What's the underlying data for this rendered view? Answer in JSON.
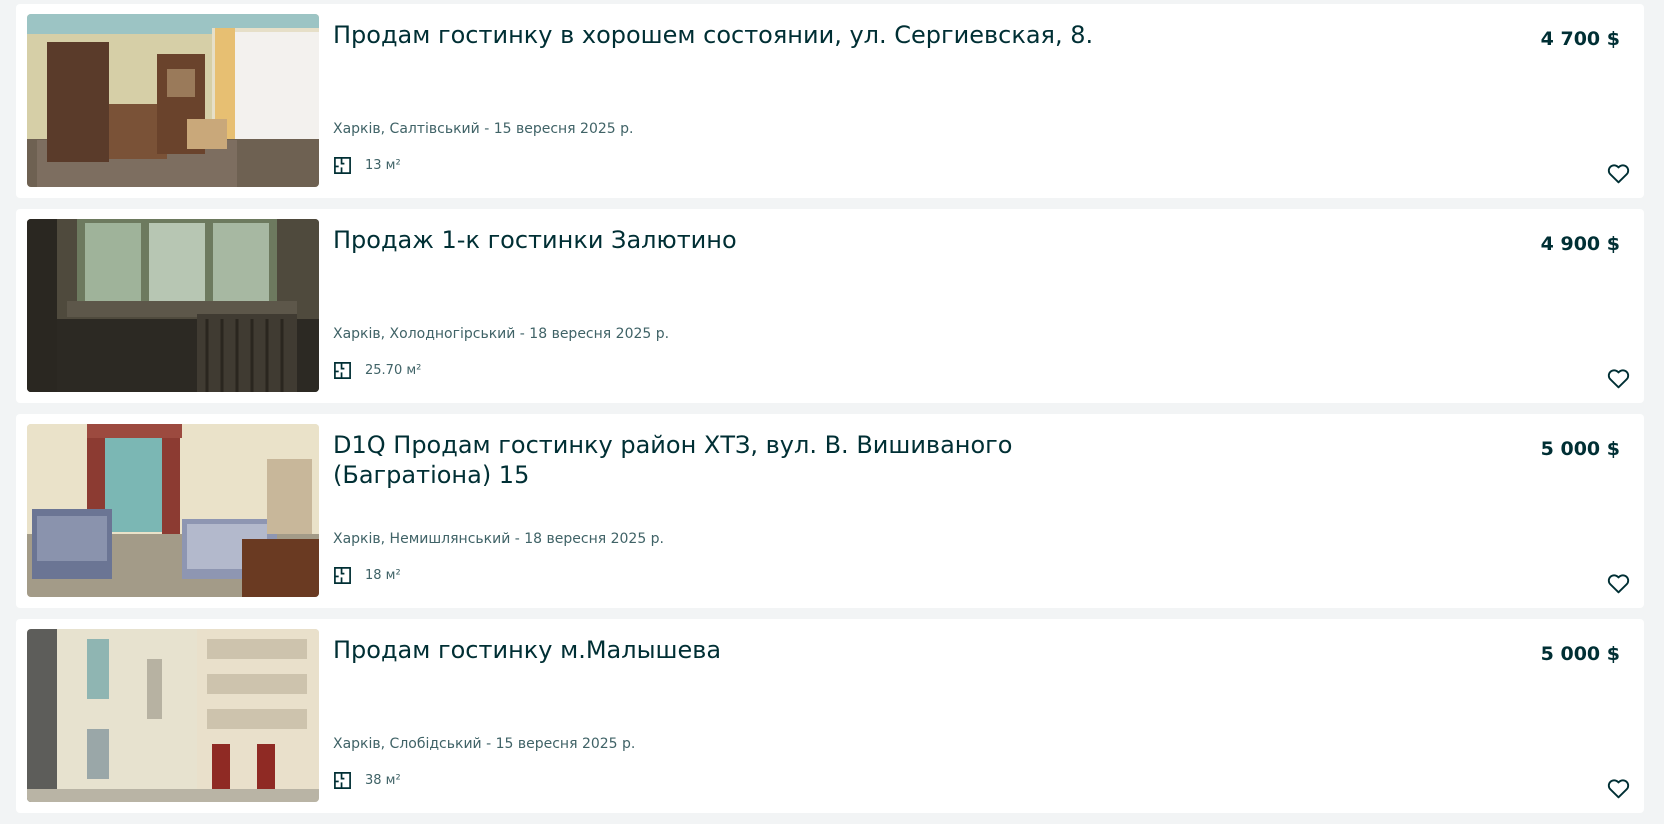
{
  "listings": [
    {
      "title": "Продам гостинку в хорошем состоянии, ул. Сергиевская, 8.",
      "price": "4 700 $",
      "location_date": "Харків, Салтівський - 15 вересня 2025 р.",
      "area": "13 м²",
      "photo": "room-with-wardrobe-photo"
    },
    {
      "title": "Продаж 1-к гостинки Залютино",
      "price": "4 900 $",
      "location_date": "Харків, Холодногірський - 18 вересня 2025 р.",
      "area": "25.70 м²",
      "photo": "window-and-radiator-photo"
    },
    {
      "title": "D1Q Продам гостинку район ХТЗ, вул. В. Вишиваного (Багратіона) 15",
      "price": "5 000 $",
      "location_date": "Харків, Немишлянський - 18 вересня 2025 р.",
      "area": "18 м²",
      "photo": "room-with-sofa-photo"
    },
    {
      "title": "Продам гостинку м.Малышева",
      "price": "5 000 $",
      "location_date": "Харків, Слобідський - 15 вересня 2025 р.",
      "area": "38 м²",
      "photo": "building-exterior-photo"
    }
  ],
  "icons": {
    "area": "floor-plan-icon",
    "favorite": "heart-outline-icon"
  },
  "colors": {
    "text_primary": "#002f34",
    "text_secondary": "#406367",
    "background": "#f2f4f5",
    "card": "#ffffff"
  }
}
